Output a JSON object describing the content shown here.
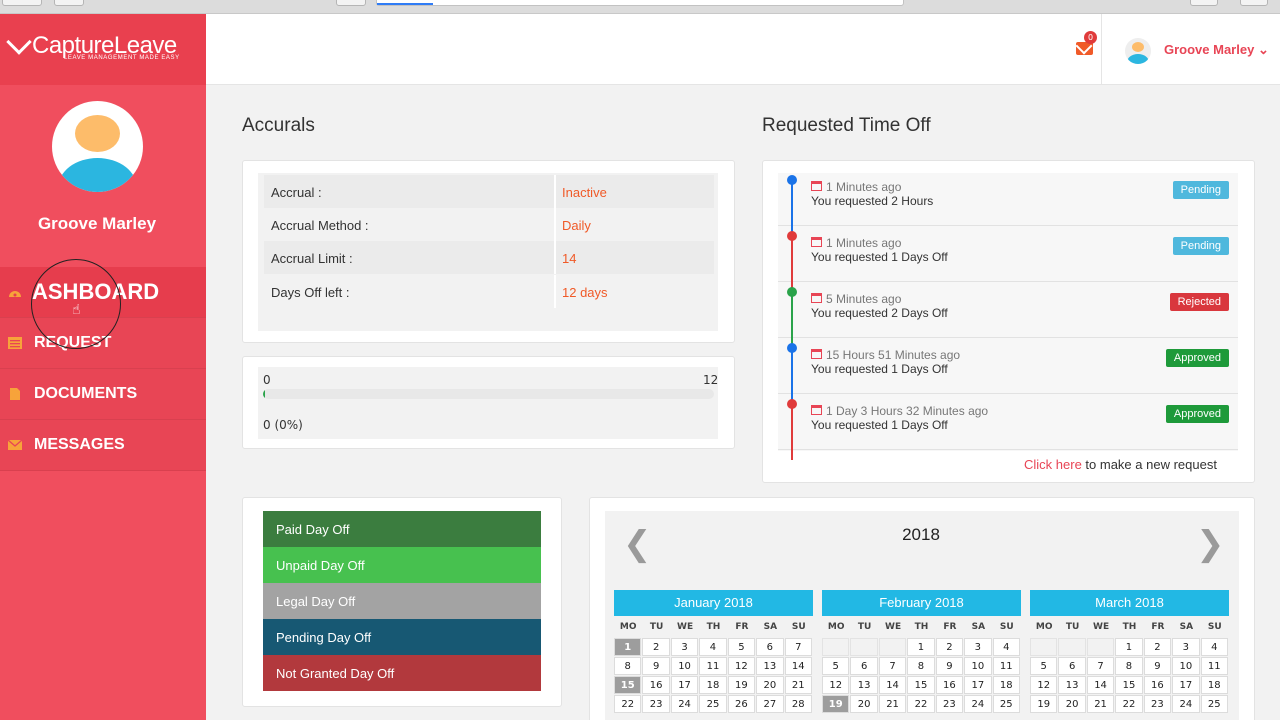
{
  "sidebar": {
    "logo_text": "CaptureLeave",
    "logo_tagline": "LEAVE MANAGEMENT MADE EASY",
    "user_name": "Groove Marley",
    "menu": [
      {
        "label": "ASHBOARD",
        "icon": "dashboard-icon",
        "active": true
      },
      {
        "label": "REQUEST",
        "icon": "request-list-icon",
        "active": false
      },
      {
        "label": "DOCUMENTS",
        "icon": "document-icon",
        "active": false
      },
      {
        "label": "MESSAGES",
        "icon": "envelope-icon",
        "active": false
      }
    ]
  },
  "header": {
    "mail_count": "0",
    "user_name": "Groove Marley",
    "user_caret": "⌄"
  },
  "accruals": {
    "title": "Accurals",
    "rows": [
      {
        "label": "Accrual :",
        "value": "Inactive"
      },
      {
        "label": "Accrual Method :",
        "value": "Daily"
      },
      {
        "label": "Accrual Limit :",
        "value": "14"
      },
      {
        "label": "Days Off left :",
        "value": "12 days"
      }
    ],
    "progress": {
      "min": "0",
      "max": "12",
      "label": "0 (0%)",
      "fraction": 0.005
    }
  },
  "requested": {
    "title": "Requested Time Off",
    "items": [
      {
        "time": "1 Minutes ago",
        "desc": "You requested 2 Hours",
        "status": "Pending",
        "dot": "#1a73e8"
      },
      {
        "time": "1 Minutes ago",
        "desc": "You requested 1 Days Off",
        "status": "Pending",
        "dot": "#e03b3b"
      },
      {
        "time": "5 Minutes ago",
        "desc": "You requested 2 Days Off",
        "status": "Rejected",
        "dot": "#2aa34a"
      },
      {
        "time": "15 Hours 51 Minutes ago",
        "desc": "You requested 1 Days Off",
        "status": "Approved",
        "dot": "#1a73e8"
      },
      {
        "time": "1 Day 3 Hours 32 Minutes ago",
        "desc": "You requested 1 Days Off",
        "status": "Approved",
        "dot": "#e03b3b"
      }
    ],
    "status_colors": {
      "Pending": "#4fb8dd",
      "Rejected": "#d9373d",
      "Approved": "#1e9a3a"
    },
    "footer_link": "Click here",
    "footer_text": " to make a new request"
  },
  "legend": [
    {
      "label": "Paid Day Off",
      "color": "#3b7d3f"
    },
    {
      "label": "Unpaid Day Off",
      "color": "#47c14f"
    },
    {
      "label": "Legal Day Off",
      "color": "#a3a3a3"
    },
    {
      "label": "Pending Day Off",
      "color": "#175873"
    },
    {
      "label": "Not Granted Day Off",
      "color": "#b2393d"
    }
  ],
  "calendar": {
    "year": "2018",
    "prev": "❮",
    "next": "❯",
    "dows": [
      "MO",
      "TU",
      "WE",
      "TH",
      "FR",
      "SA",
      "SU"
    ],
    "months": [
      {
        "name": "January 2018",
        "days": [
          "1",
          "2",
          "3",
          "4",
          "5",
          "6",
          "7",
          "8",
          "9",
          "10",
          "11",
          "12",
          "13",
          "14",
          "15",
          "16",
          "17",
          "18",
          "19",
          "20",
          "21",
          "22",
          "23",
          "24",
          "25",
          "26",
          "27",
          "28"
        ],
        "lead": 0,
        "highlight": [
          "1",
          "15"
        ]
      },
      {
        "name": "February 2018",
        "days": [
          "1",
          "2",
          "3",
          "4",
          "5",
          "6",
          "7",
          "8",
          "9",
          "10",
          "11",
          "12",
          "13",
          "14",
          "15",
          "16",
          "17",
          "18",
          "19",
          "20",
          "21",
          "22",
          "23",
          "24",
          "25"
        ],
        "lead": 3,
        "highlight": [
          "19"
        ]
      },
      {
        "name": "March 2018",
        "days": [
          "1",
          "2",
          "3",
          "4",
          "5",
          "6",
          "7",
          "8",
          "9",
          "10",
          "11",
          "12",
          "13",
          "14",
          "15",
          "16",
          "17",
          "18",
          "19",
          "20",
          "21",
          "22",
          "23",
          "24",
          "25"
        ],
        "lead": 3,
        "highlight": []
      }
    ]
  }
}
